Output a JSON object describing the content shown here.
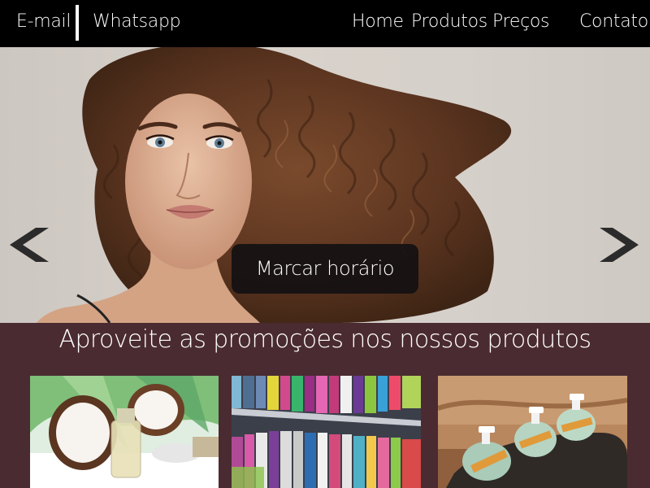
{
  "nav": {
    "email": "E-mail",
    "whatsapp": "Whatsapp",
    "home": "Home",
    "produtos": "Produtos",
    "precos": "Preços",
    "contato": "Contato"
  },
  "hero": {
    "cta_label": "Marcar horário",
    "prev_icon": "chevron-left-icon",
    "next_icon": "chevron-right-icon"
  },
  "promo": {
    "title": "Aproveite as promoções nos nossos produtos"
  },
  "colors": {
    "topbar": "#000000",
    "section_bg": "#4a2b31",
    "cta_bg": "#141012",
    "text": "#ffffff"
  }
}
